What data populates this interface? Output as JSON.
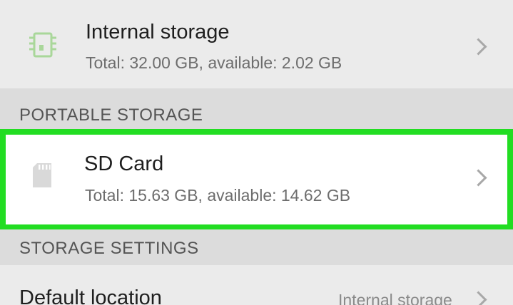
{
  "internal_storage": {
    "title": "Internal storage",
    "subtitle": "Total: 32.00 GB, available: 2.02 GB",
    "icon": "chip-icon"
  },
  "sections": {
    "portable": "PORTABLE STORAGE",
    "settings": "STORAGE SETTINGS"
  },
  "sd_card": {
    "title": "SD Card",
    "subtitle": "Total: 15.63 GB, available: 14.62 GB",
    "icon": "sd-card-icon"
  },
  "default_location": {
    "title": "Default location",
    "value": "Internal storage"
  },
  "colors": {
    "highlight_border": "#22dd22",
    "chip_icon": "#a9d79a"
  }
}
